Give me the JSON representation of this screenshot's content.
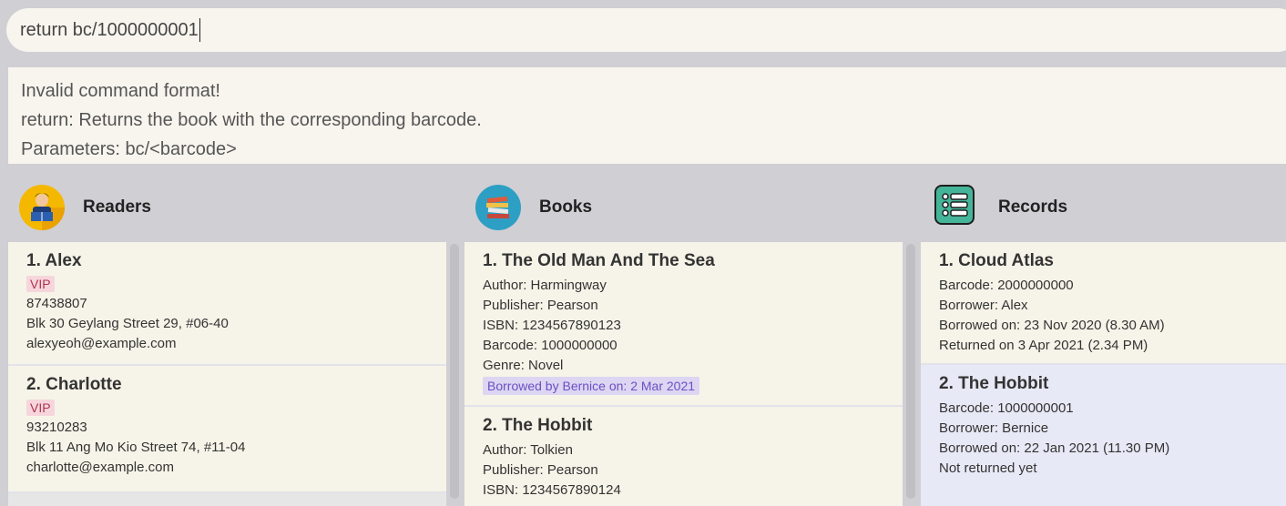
{
  "command": {
    "value": "return bc/1000000001"
  },
  "result": {
    "lines": [
      "Invalid command format!",
      "return: Returns the book with the corresponding barcode.",
      "Parameters: bc/<barcode>"
    ]
  },
  "columns": {
    "readers": {
      "title": "Readers",
      "icon": "reader-icon"
    },
    "books": {
      "title": "Books",
      "icon": "books-icon"
    },
    "records": {
      "title": "Records",
      "icon": "list-icon"
    }
  },
  "readers": [
    {
      "name": "1.  Alex",
      "tag": "VIP",
      "phone": "87438807",
      "address": "Blk 30 Geylang Street 29, #06-40",
      "email": "alexyeoh@example.com"
    },
    {
      "name": "2.  Charlotte",
      "tag": "VIP",
      "phone": "93210283",
      "address": "Blk 11 Ang Mo Kio Street 74, #11-04",
      "email": "charlotte@example.com"
    }
  ],
  "books": [
    {
      "title": "1.  The Old Man And The Sea",
      "author": "Author: Harmingway",
      "publisher": "Publisher: Pearson",
      "isbn": "ISBN: 1234567890123",
      "barcode": "Barcode: 1000000000",
      "genre": "Genre: Novel",
      "status": "Borrowed by Bernice on: 2 Mar 2021"
    },
    {
      "title": "2.  The Hobbit",
      "author": "Author: Tolkien",
      "publisher": "Publisher: Pearson",
      "isbn": "ISBN: 1234567890124"
    }
  ],
  "records": [
    {
      "title": "1.  Cloud Atlas",
      "barcode": "Barcode: 2000000000",
      "borrower": "Borrower: Alex",
      "borrowed": "Borrowed on: 23 Nov 2020 (8.30 AM)",
      "returned": "Returned on 3 Apr 2021 (2.34 PM)"
    },
    {
      "title": "2.  The Hobbit",
      "barcode": "Barcode: 1000000001",
      "borrower": "Borrower: Bernice",
      "borrowed": "Borrowed on: 22 Jan 2021 (11.30 PM)",
      "returned": "Not returned yet"
    }
  ],
  "colors": {
    "background": "#d0cfd4",
    "card": "#f6f4e8",
    "selected_card": "#e8e9f6",
    "vip_tag": "#f6d6dc",
    "borrow_tag": "#dcd6f2"
  }
}
